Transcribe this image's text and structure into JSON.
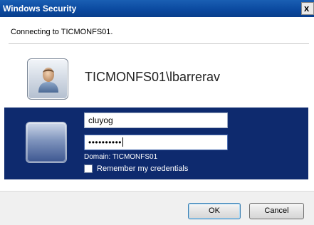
{
  "window": {
    "title": "Windows Security",
    "close_glyph": "x"
  },
  "status_text": "Connecting to TICMONFS01.",
  "account": {
    "name": "TICMONFS01\\lbarrerav",
    "icon": "user-icon"
  },
  "credentials": {
    "username_value": "cluyog",
    "password_mask": "••••••••••",
    "domain_text": "Domain: TICMONFS01",
    "remember_label": "Remember my credentials",
    "remember_checked": false,
    "panel_color": "#0e2a6e"
  },
  "buttons": {
    "ok": "OK",
    "cancel": "Cancel"
  }
}
